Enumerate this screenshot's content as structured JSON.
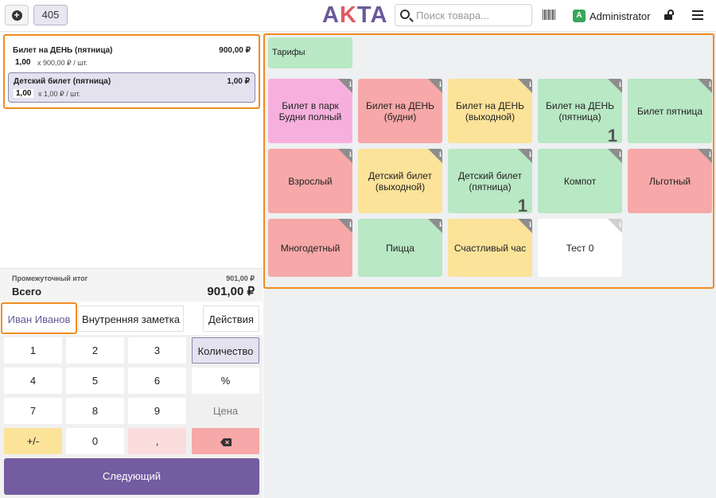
{
  "header": {
    "order_number": "405",
    "logo_text_a": "A",
    "logo_text_k": "K",
    "logo_text_ta": "TA",
    "search_placeholder": "Поиск товара...",
    "user_initial": "A",
    "user_name": "Administrator"
  },
  "ticket": {
    "lines": [
      {
        "name": "Билет на ДЕНЬ (пятница)",
        "price": "900,00 ₽",
        "qty": "1,00",
        "unit": "x 900,00 ₽ / шт."
      },
      {
        "name": "Детский билет (пятница)",
        "price": "1,00 ₽",
        "qty": "1,00",
        "unit": "x 1,00 ₽ / шт."
      }
    ],
    "subtotal_label": "Промежуточный итог",
    "subtotal_value": "901,00 ₽",
    "total_label": "Всего",
    "total_value": "901,00 ₽"
  },
  "actions": {
    "customer": "Иван Иванов",
    "note": "Внутренняя заметка",
    "actions": "Действия"
  },
  "numpad": {
    "k1": "1",
    "k2": "2",
    "k3": "3",
    "k4": "4",
    "k5": "5",
    "k6": "6",
    "k7": "7",
    "k8": "8",
    "k9": "9",
    "sign": "+/-",
    "k0": "0",
    "comma": ",",
    "qty": "Количество",
    "percent": "%",
    "price": "Цена",
    "next": "Следующий"
  },
  "products": {
    "category": "Тарифы",
    "tiles": [
      {
        "name": "Билет в парк Будни полный",
        "color": "#f7b0dd",
        "count": ""
      },
      {
        "name": "Билет на ДЕНЬ (будни)",
        "color": "#f7a8a8",
        "count": ""
      },
      {
        "name": "Билет на ДЕНЬ (выходной)",
        "color": "#fbe39a",
        "count": ""
      },
      {
        "name": "Билет на ДЕНЬ (пятница)",
        "color": "#b9e8c4",
        "count": "1"
      },
      {
        "name": "Билет пятница",
        "color": "#b9e8c4",
        "count": ""
      },
      {
        "name": "Взрослый",
        "color": "#f7a8a8",
        "count": ""
      },
      {
        "name": "Детский билет (выходной)",
        "color": "#fbe39a",
        "count": ""
      },
      {
        "name": "Детский билет (пятница)",
        "color": "#b9e8c4",
        "count": "1"
      },
      {
        "name": "Компот",
        "color": "#b9e8c4",
        "count": ""
      },
      {
        "name": "Льготный",
        "color": "#f7a8a8",
        "count": ""
      },
      {
        "name": "Многодетный",
        "color": "#f7a8a8",
        "count": ""
      },
      {
        "name": "Пицца",
        "color": "#b9e8c4",
        "count": ""
      },
      {
        "name": "Счастливый час",
        "color": "#fbe39a",
        "count": ""
      },
      {
        "name": "Тест 0",
        "color": "#ffffff",
        "count": ""
      }
    ]
  },
  "colors": {
    "accent": "#735c9f",
    "highlight_border": "#f08c21"
  }
}
